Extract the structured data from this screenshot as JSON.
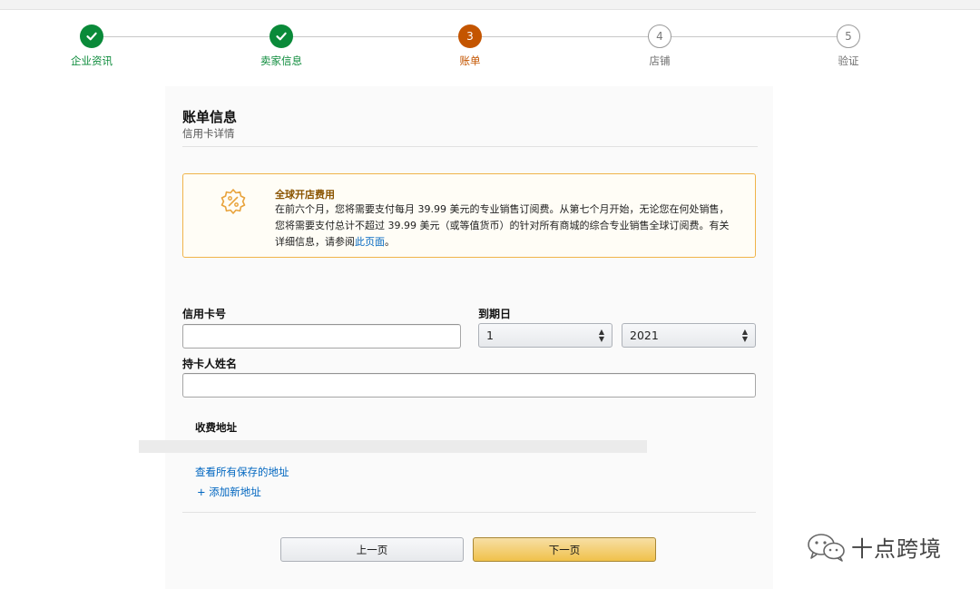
{
  "stepper": {
    "steps": [
      {
        "label": "企业资讯",
        "number": "",
        "state": "done"
      },
      {
        "label": "卖家信息",
        "number": "",
        "state": "done"
      },
      {
        "label": "账单",
        "number": "3",
        "state": "current"
      },
      {
        "label": "店铺",
        "number": "4",
        "state": "todo"
      },
      {
        "label": "验证",
        "number": "5",
        "state": "todo"
      }
    ]
  },
  "billing": {
    "title": "账单信息",
    "subtitle": "信用卡详情"
  },
  "notice": {
    "title": "全球开店费用",
    "body": "在前六个月，您将需要支付每月 39.99 美元的专业销售订阅费。从第七个月开始，无论您在何处销售，您将需要支付总计不超过 39.99 美元（或等值货币）的针对所有商城的综合专业销售全球订阅费。有关详细信息，请参阅",
    "link_text": "此页面",
    "body_end": "。"
  },
  "form": {
    "card_number_label": "信用卡号",
    "card_number_value": "",
    "expiry_label": "到期日",
    "expiry_month": "1",
    "expiry_year": "2021",
    "holder_label": "持卡人姓名",
    "holder_value": ""
  },
  "address": {
    "title": "收费地址",
    "view_saved_link": "查看所有保存的地址",
    "add_new_link": "+ 添加新地址"
  },
  "buttons": {
    "prev": "上一页",
    "next": "下一页"
  },
  "watermark": {
    "text": "十点跨境"
  },
  "colors": {
    "done": "#0a8a39",
    "current": "#c45500",
    "link": "#0066c0",
    "notice_border": "#f0b44a",
    "next_button": "#f0c14b"
  }
}
